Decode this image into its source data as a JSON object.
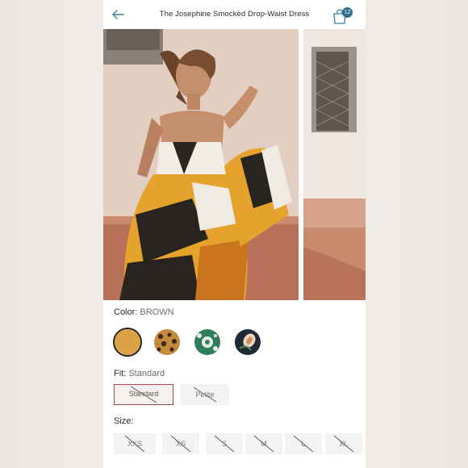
{
  "header": {
    "title": "The Josephine Smocked Drop-Waist Dress",
    "cart_count": "12"
  },
  "colors": {
    "accent": "#2e6f8f",
    "selected_outline": "#a94949"
  },
  "color_option": {
    "label": "Color:",
    "value": "BROWN",
    "swatches": [
      "brown-solid",
      "leopard-print",
      "green-floral",
      "navy-floral"
    ]
  },
  "fit_option": {
    "label": "Fit:",
    "value": "Standard",
    "options": [
      "Standard",
      "Petite"
    ]
  },
  "size_option": {
    "label": "Size:",
    "options": [
      "XXS",
      "XS",
      "S",
      "M",
      "L",
      "XL"
    ]
  }
}
